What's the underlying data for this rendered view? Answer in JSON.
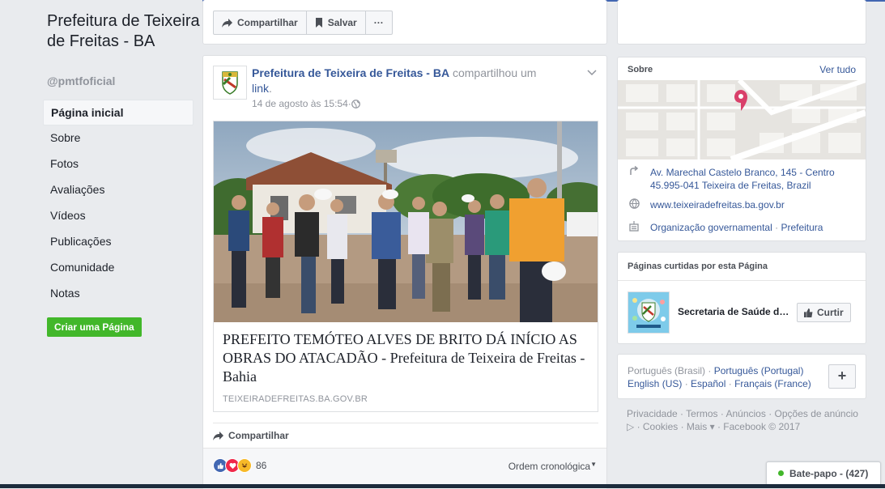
{
  "page": {
    "title": "Prefeitura de Teixeira de Freitas - BA",
    "handle": "@pmtfoficial"
  },
  "nav": {
    "items": [
      {
        "label": "Página inicial",
        "active": true
      },
      {
        "label": "Sobre"
      },
      {
        "label": "Fotos"
      },
      {
        "label": "Avaliações"
      },
      {
        "label": "Vídeos"
      },
      {
        "label": "Publicações"
      },
      {
        "label": "Comunidade"
      },
      {
        "label": "Notas"
      }
    ],
    "create_page": "Criar uma Página"
  },
  "actions": {
    "share": "Compartilhar",
    "save": "Salvar",
    "more": "···"
  },
  "post": {
    "author": "Prefeitura de Teixeira de Freitas - BA",
    "action": "compartilhou um",
    "link_word": "link",
    "time": "14 de agosto às 15:54",
    "separator": " · ",
    "shared_title": "PREFEITO TEMÓTEO ALVES DE BRITO DÁ INÍCIO AS OBRAS DO ATACADÃO - Prefeitura de Teixeira de Freitas - Bahia",
    "shared_domain": "TEIXEIRADEFREITAS.BA.GOV.BR",
    "share_label": "Compartilhar",
    "reaction_count": "86",
    "order_label": "Ordem cronológica"
  },
  "about": {
    "header": "Sobre",
    "see_all": "Ver tudo",
    "address": "Av. Marechal Castelo Branco, 145 - Centro 45.995-041 Teixeira de Freitas, Brazil",
    "website": "www.teixeiradefreitas.ba.gov.br",
    "category_1": "Organização governamental",
    "category_sep": " · ",
    "category_2": "Prefeitura"
  },
  "liked": {
    "header": "Páginas curtidas por esta Página",
    "name": "Secretaria de Saúde de Teixeira de Freitas",
    "like_button": "Curtir"
  },
  "languages": {
    "current": "Português (Brasil)",
    "sep": " · ",
    "others": [
      "Português (Portugal)",
      "English (US)",
      "Español",
      "Français (France)"
    ],
    "plus": "+"
  },
  "footer": {
    "text": "Privacidade · Termos · Anúncios · Opções de anúncio ▷ · Cookies · Mais ▾ · Facebook © 2017"
  },
  "chat": {
    "label": "Bate-papo - (427)"
  },
  "colors": {
    "link_blue": "#365899",
    "green": "#42b72a",
    "bg": "#e9ebee"
  }
}
